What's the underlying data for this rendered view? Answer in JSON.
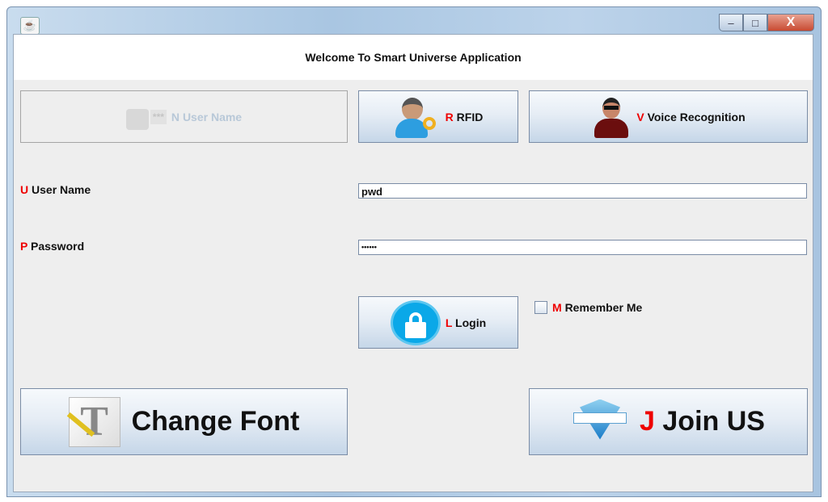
{
  "window": {
    "title_bar_buttons": {
      "minimize": "–",
      "maximize": "□",
      "close": "X"
    }
  },
  "header": {
    "title": "Welcome To Smart Universe Application"
  },
  "top_buttons": [
    {
      "mnemonic": "N",
      "label": "User Name",
      "enabled": false
    },
    {
      "mnemonic": "R",
      "label": "RFID",
      "enabled": true
    },
    {
      "mnemonic": "V",
      "label": "Voice Recognition",
      "enabled": true
    }
  ],
  "form": {
    "username": {
      "mnemonic": "U",
      "label": "User Name",
      "value": "pwd"
    },
    "password": {
      "mnemonic": "P",
      "label": "Password",
      "value": "••••••"
    }
  },
  "login": {
    "mnemonic": "L",
    "label": "Login"
  },
  "remember": {
    "mnemonic": "M",
    "label": "Remember Me",
    "checked": false
  },
  "change_font": {
    "label": "Change Font"
  },
  "join": {
    "mnemonic": "J",
    "label": "Join US"
  },
  "colors": {
    "mnemonic": "#ee0000",
    "button_border": "#7a8ca6",
    "background": "#eeeeee"
  }
}
